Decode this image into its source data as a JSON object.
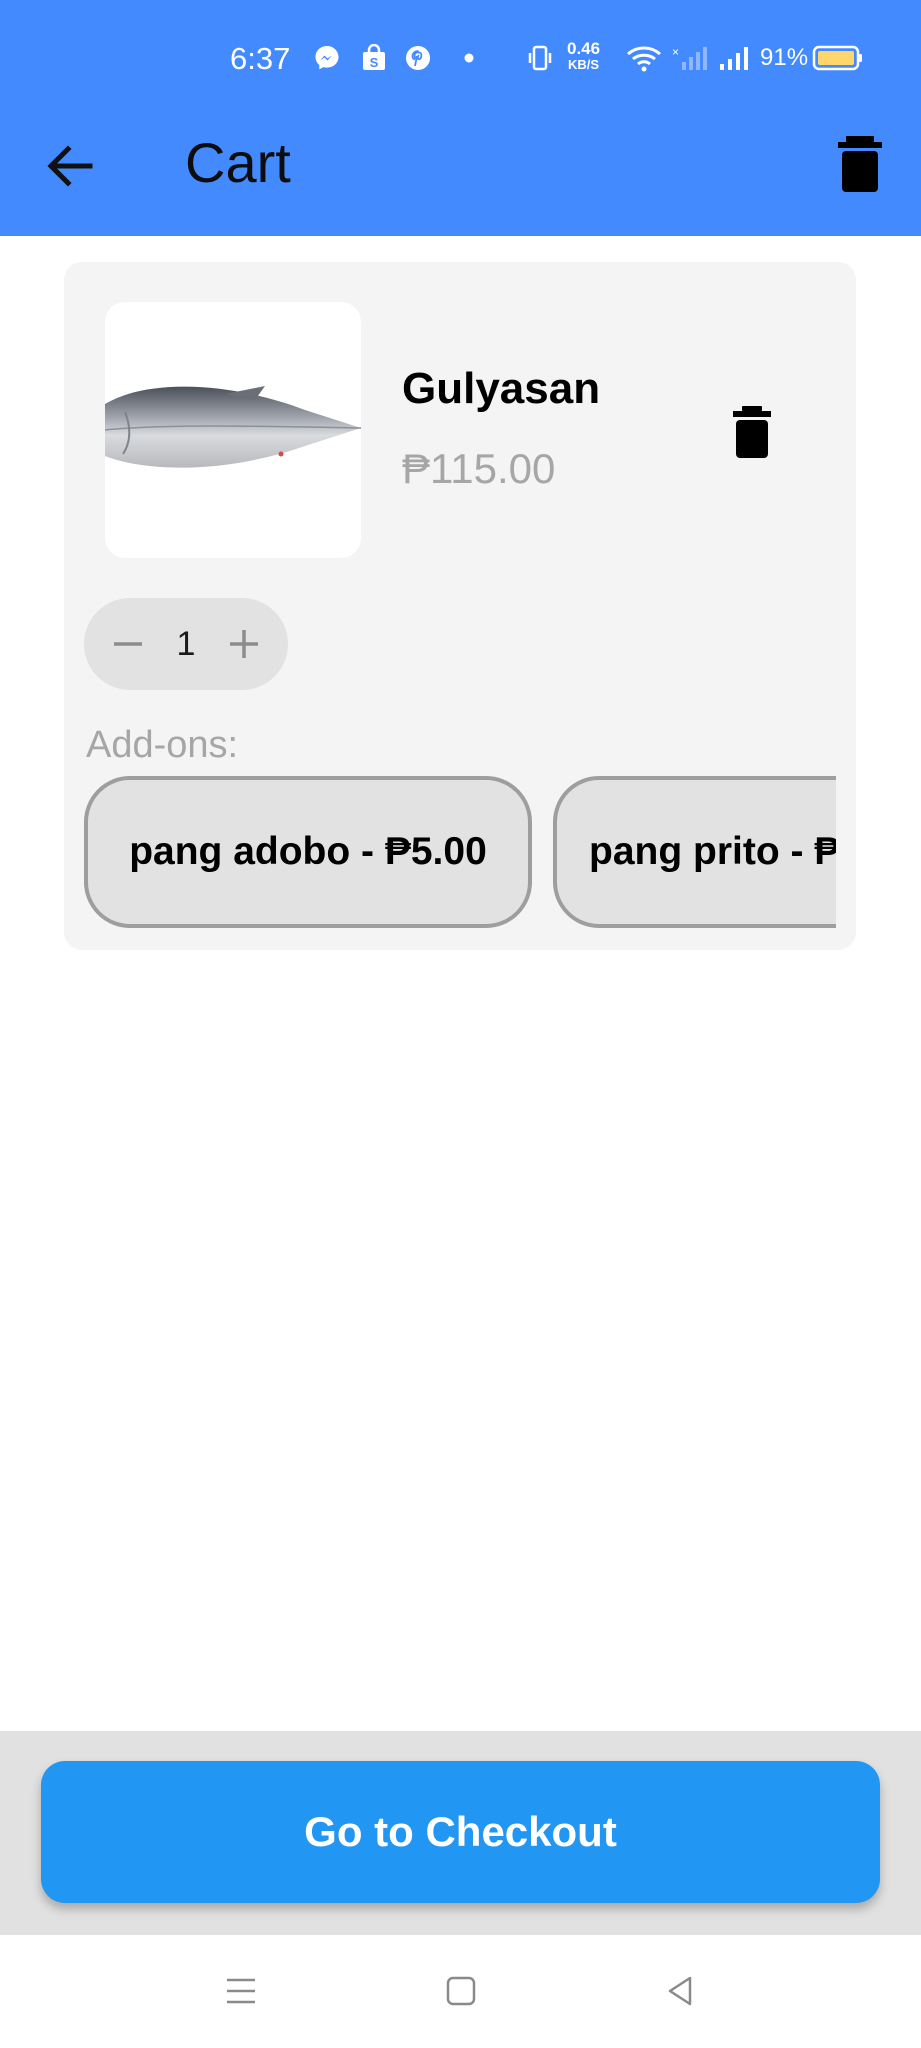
{
  "status_bar": {
    "time": "6:37",
    "net_speed_value": "0.46",
    "net_speed_unit": "KB/S",
    "battery_percent": "91%"
  },
  "app_bar": {
    "title": "Cart",
    "back_icon": "arrow-left-icon",
    "clear_icon": "trash-icon"
  },
  "cart": {
    "items": [
      {
        "name": "Gulyasan",
        "price": "₱115.00",
        "quantity": "1",
        "addons_label": "Add-ons:",
        "addons": [
          "pang adobo - ₱5.00",
          "pang prito - ₱"
        ]
      }
    ]
  },
  "checkout": {
    "label": "Go to Checkout"
  },
  "colors": {
    "app_bar": "#448aff",
    "checkout_button": "#2196f3",
    "card_background": "#f4f4f4",
    "muted_text": "#a6a6a6"
  }
}
